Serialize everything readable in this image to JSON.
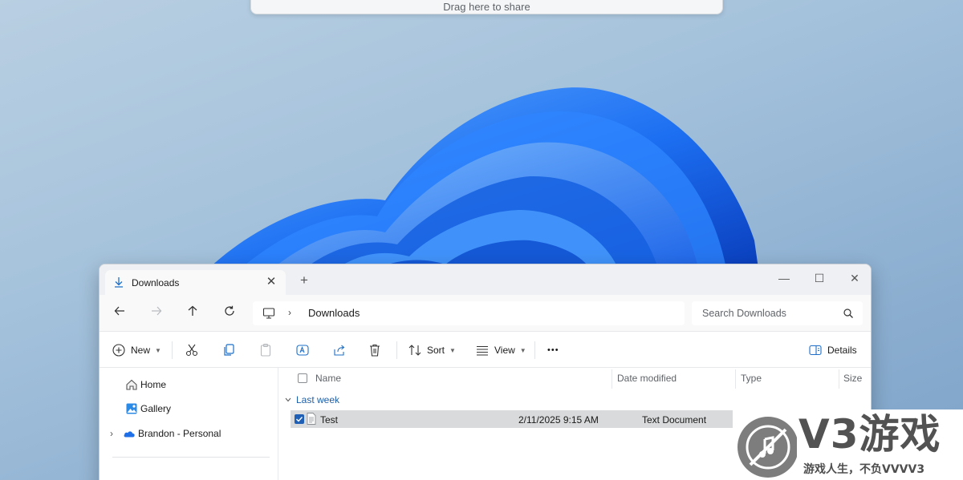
{
  "share_bar": {
    "text": "Drag here to share"
  },
  "tab": {
    "label": "Downloads",
    "close": "✕",
    "new_tab": "+"
  },
  "window_controls": {
    "minimize": "—",
    "maximize": "☐",
    "close": "✕"
  },
  "address": {
    "separator": "›",
    "location": "Downloads"
  },
  "search": {
    "placeholder": "Search Downloads"
  },
  "commands": {
    "new_label": "New",
    "sort_label": "Sort",
    "view_label": "View",
    "more_label": "•••",
    "details_label": "Details"
  },
  "nav_pane": {
    "items": [
      {
        "label": "Home",
        "icon": "home-icon"
      },
      {
        "label": "Gallery",
        "icon": "gallery-icon"
      },
      {
        "label": "Brandon - Personal",
        "icon": "onedrive-icon",
        "expandable": true
      }
    ]
  },
  "columns": {
    "name": "Name",
    "date": "Date modified",
    "type": "Type",
    "size": "Size"
  },
  "groups": [
    {
      "label": "Last week",
      "files": [
        {
          "name": "Test",
          "date": "2/11/2025 9:15 AM",
          "type": "Text Document",
          "size": "",
          "selected": true
        }
      ]
    }
  ],
  "watermark": {
    "brand": "V3游戏",
    "slogan": "游戏人生，不负VVVV3"
  },
  "colors": {
    "accent": "#1f5fb5",
    "wallpaper": "#9dbbd8",
    "bloom": "#1f6fe8",
    "group_label": "#1d5fa8",
    "selected_row": "#d9dadb"
  }
}
